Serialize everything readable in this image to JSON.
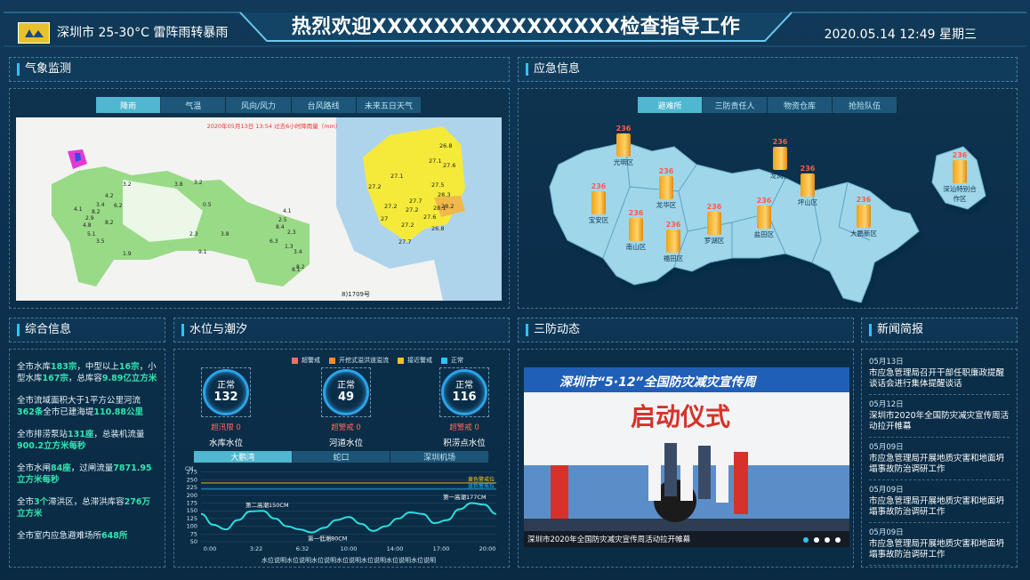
{
  "header": {
    "weather": "深圳市 25-30°C  雷阵雨转暴雨",
    "title": "热烈欢迎XXXXXXXXXXXXXXXX检查指导工作",
    "datetime": "2020.05.14 12:49  星期三"
  },
  "weather_panel": {
    "title": "气象监测",
    "tabs": [
      "降雨",
      "气温",
      "风向/风力",
      "台风路线",
      "未来五日天气"
    ],
    "active_tab": 0,
    "map_caption": "2020年05月13日 13:54 过去6小时降雨量（mm）",
    "map_footer": "8)1709号",
    "left_values": [
      "3.2",
      "4.2",
      "3.2",
      "2.5",
      "3.8",
      "3.8",
      "1.9",
      "2.3",
      "4.1",
      "3.4",
      "6.2",
      "2.9",
      "8.2",
      "4.8",
      "5.1",
      "3.5",
      "8.2",
      "9.1",
      "0.5",
      "6.3",
      "8.4",
      "4.1",
      "8.1",
      "2.3",
      "1.3",
      "3.4",
      "8.2"
    ],
    "right_values": [
      "26.8",
      "27.1",
      "27.6",
      "27.1",
      "27.2",
      "27.5",
      "28.3",
      "27.2",
      "27.7",
      "27.2",
      "28.1",
      "28.2",
      "27",
      "27.6",
      "27.2",
      "26.8",
      "27.7"
    ]
  },
  "emergency_panel": {
    "title": "应急信息",
    "tabs": [
      "避难所",
      "三防责任人",
      "物资仓库",
      "抢险队伍"
    ],
    "active_tab": 0,
    "districts": [
      {
        "name": "光明区",
        "value": "236"
      },
      {
        "name": "宝安区",
        "value": "236"
      },
      {
        "name": "龙华区",
        "value": "236"
      },
      {
        "name": "南山区",
        "value": "236"
      },
      {
        "name": "福田区",
        "value": "236"
      },
      {
        "name": "罗湖区",
        "value": "236"
      },
      {
        "name": "龙岗区",
        "value": "236"
      },
      {
        "name": "坪山区",
        "value": "236"
      },
      {
        "name": "盐田区",
        "value": "236"
      },
      {
        "name": "大鹏新区",
        "value": "236"
      },
      {
        "name": "深汕特别合作区",
        "value": "236"
      }
    ]
  },
  "summary_panel": {
    "title": "综合信息",
    "items": [
      [
        {
          "t": "全市水库"
        },
        {
          "t": "183宗",
          "h": true
        },
        {
          "t": "，中型以上"
        },
        {
          "t": "16宗",
          "h": true
        },
        {
          "t": "，小型水库"
        },
        {
          "t": "167宗",
          "h": true
        },
        {
          "t": "，总库容"
        },
        {
          "t": "9.89亿立方米",
          "h": true
        }
      ],
      [
        {
          "t": "全市流域面积大于1平方公里河流"
        },
        {
          "t": "362条",
          "h": true
        },
        {
          "t": "全市已建海堤"
        },
        {
          "t": "110.88公里",
          "h": true
        }
      ],
      [
        {
          "t": "全市排涝泵站"
        },
        {
          "t": "131座",
          "h": true
        },
        {
          "t": "，总装机流量"
        },
        {
          "t": "900.2立方米每秒",
          "h": true
        }
      ],
      [
        {
          "t": "全市水闸"
        },
        {
          "t": "84座",
          "h": true
        },
        {
          "t": "，过闸流量"
        },
        {
          "t": "7871.95立方米每秒",
          "h": true
        }
      ],
      [
        {
          "t": "全市"
        },
        {
          "t": "3个",
          "h": true
        },
        {
          "t": "滞洪区，总滞洪库容"
        },
        {
          "t": "276万立方米",
          "h": true
        }
      ],
      [
        {
          "t": "全市室内应急避难场所"
        },
        {
          "t": "648所",
          "h": true
        }
      ]
    ]
  },
  "water_panel": {
    "title": "水位与潮汐",
    "legend": [
      {
        "label": "超警戒",
        "color": "#ff6b6b"
      },
      {
        "label": "开挖式溢洪道溢流",
        "color": "#ff8c2a"
      },
      {
        "label": "接近警戒",
        "color": "#ffc21a"
      },
      {
        "label": "正常",
        "color": "#2ec3ff"
      }
    ],
    "gauges": [
      {
        "status": "正常",
        "value": "132",
        "warn": "超汛限 0",
        "name": "水库水位"
      },
      {
        "status": "正常",
        "value": "49",
        "warn": "超警戒 0",
        "name": "河道水位"
      },
      {
        "status": "正常",
        "value": "116",
        "warn": "超警戒 0",
        "name": "积涝点水位"
      }
    ],
    "tabs": [
      "大鹏湾",
      "蛇口",
      "深圳机场"
    ],
    "active_tab": 0,
    "chart_data": {
      "type": "line",
      "ylabel": "CM",
      "ylim": [
        50,
        280
      ],
      "yticks": [
        50,
        75,
        100,
        125,
        150,
        175,
        200,
        225,
        250,
        275
      ],
      "xticks": [
        "0:00",
        "3:22",
        "6:32",
        "10:00",
        "14:00",
        "17:00",
        "20:00"
      ],
      "x": [
        0,
        1,
        2,
        3,
        4,
        5,
        6,
        7,
        8,
        9,
        10,
        11,
        12,
        13,
        14,
        15,
        16,
        17,
        18,
        19,
        20,
        21,
        22,
        23,
        24
      ],
      "series": [
        {
          "values": [
            140,
            105,
            90,
            120,
            148,
            150,
            125,
            100,
            90,
            80,
            95,
            120,
            130,
            108,
            85,
            100,
            125,
            145,
            140,
            110,
            120,
            155,
            175,
            170,
            140
          ]
        }
      ],
      "reference_lines": [
        {
          "label": "黄色警戒位",
          "value": 240,
          "color": "#ffc21a"
        },
        {
          "label": "蓝色警戒位",
          "value": 220,
          "color": "#2ec3ff"
        }
      ],
      "annotations": [
        "第一高潮177CM",
        "第二高潮150CM",
        "第一低潮80CM"
      ],
      "caption": "水位说明水位说明水位说明水位说明水位说明水位说明水位说明"
    }
  },
  "dynamics_panel": {
    "title": "三防动态",
    "banner_title": "深圳市“5·12”全国防灾减灾宣传周",
    "banner_sub": "启动仪式",
    "caption": "深圳市2020年全国防灾减灾宣传周活动拉开帷幕"
  },
  "news_panel": {
    "title": "新闻简报",
    "items": [
      {
        "date": "05月13日",
        "text": "市应急管理局召开干部任职廉政提醒谈话会进行集体提醒谈话"
      },
      {
        "date": "05月12日",
        "text": "深圳市2020年全国防灾减灾宣传周活动拉开帷幕"
      },
      {
        "date": "05月09日",
        "text": "市应急管理局开展地质灾害和地面坍塌事故防治调研工作"
      },
      {
        "date": "05月09日",
        "text": "市应急管理局开展地质灾害和地面坍塌事故防治调研工作"
      },
      {
        "date": "05月09日",
        "text": "市应急管理局开展地质灾害和地面坍塌事故防治调研工作"
      }
    ]
  },
  "colors": {
    "accent": "#2ec3ff",
    "highlight": "#32e6b0",
    "warn": "#ff6a5a",
    "map_land": "#9fd6ea"
  }
}
